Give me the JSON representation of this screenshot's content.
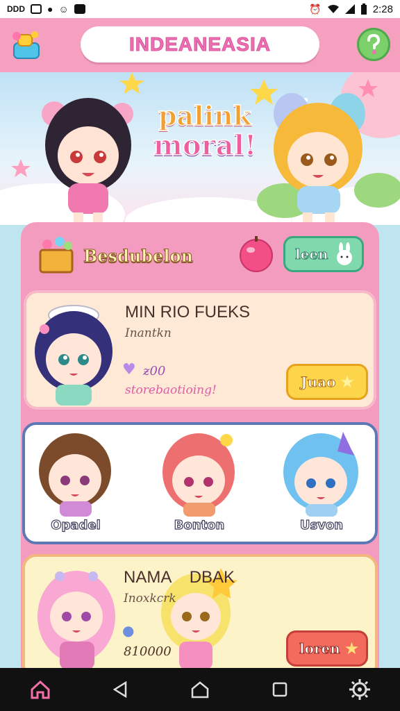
{
  "status_bar": {
    "time": "2:28",
    "icons_left": [
      "app-icon-1",
      "photo-icon",
      "circle-icon",
      "alarm-face-icon",
      "box-icon"
    ],
    "icons_right": [
      "alarm-icon",
      "wifi-icon",
      "signal-icon",
      "battery-icon"
    ]
  },
  "header": {
    "title": "INDEANEASIA",
    "menu_icon": "gift-icon",
    "help_icon": "question-icon"
  },
  "banner": {
    "line1": "palink",
    "line2": "moral!"
  },
  "panel_header": {
    "label": "Besdubelon",
    "apple_icon": "apple-icon",
    "button_label": "leen"
  },
  "card1": {
    "title": "MIN RIO FUEKS",
    "subtitle": "Inantkn",
    "count": "ƶ00",
    "tag": "storebaotioing!",
    "button_label": "Juao"
  },
  "card2": {
    "characters": [
      {
        "name": "Opadel"
      },
      {
        "name": "Bonton"
      },
      {
        "name": "Usvon"
      }
    ]
  },
  "card3": {
    "title": "NAMA    DBAK",
    "subtitle": "Inoxkcrk",
    "count": "810000",
    "button_label": "loren"
  },
  "nav": {
    "items": [
      "home-icon",
      "back-icon",
      "home-circle-icon",
      "recent-apps-icon",
      "settings-icon"
    ]
  },
  "colors": {
    "topbar": "#f4a0be",
    "panel": "#f49cbf",
    "accent_pink": "#ef6fb3"
  }
}
